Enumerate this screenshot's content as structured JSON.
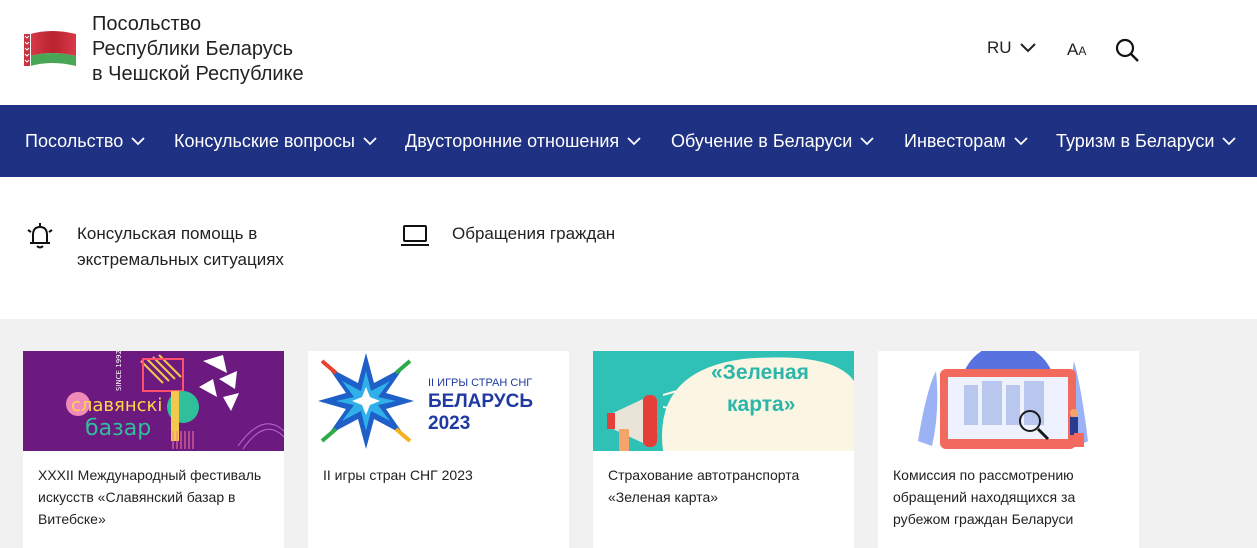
{
  "header": {
    "title_lines": [
      "Посольство",
      "Республики Беларусь",
      "в Чешской Республике"
    ],
    "lang": "RU",
    "font_big": "A",
    "font_small": "A"
  },
  "nav": {
    "items": [
      {
        "label": "Посольство"
      },
      {
        "label": "Консульские вопросы"
      },
      {
        "label": "Двусторонние отношения"
      },
      {
        "label": "Обучение в Беларуси"
      },
      {
        "label": "Инвесторам"
      },
      {
        "label": "Туризм в Беларуси"
      }
    ]
  },
  "quick_links": [
    {
      "label_line1": "Консульская помощь в",
      "label_line2": "экстремальных ситуациях",
      "icon": "bell-alarm-icon"
    },
    {
      "label_line1": "Обращения граждан",
      "label_line2": "",
      "icon": "laptop-icon"
    }
  ],
  "cards": [
    {
      "lines": [
        "XXXII Международный фестиваль",
        "искусств «Славянский базар в",
        "Витебске»"
      ],
      "image_text": {
        "since": "SINCE 1992",
        "word1": "славянскі",
        "word2": "базар"
      }
    },
    {
      "lines": [
        "II игры стран СНГ 2023"
      ],
      "image_text": {
        "top": "II ИГРЫ СТРАН СНГ",
        "mid": "БЕЛАРУСЬ",
        "year": "2023"
      }
    },
    {
      "lines": [
        "Страхование автотранспорта",
        "«Зеленая карта»"
      ],
      "image_text": {
        "line1": "«Зеленая",
        "line2": "карта»"
      }
    },
    {
      "lines": [
        "Комиссия по рассмотрению",
        "обращений находящихся за",
        "рубежом граждан Беларуси"
      ],
      "image_text": {}
    }
  ],
  "colors": {
    "nav_bg": "#1f3182",
    "cards_bg": "#f1f1f1",
    "flag_red": "#c8313e",
    "flag_green": "#4aa657"
  }
}
